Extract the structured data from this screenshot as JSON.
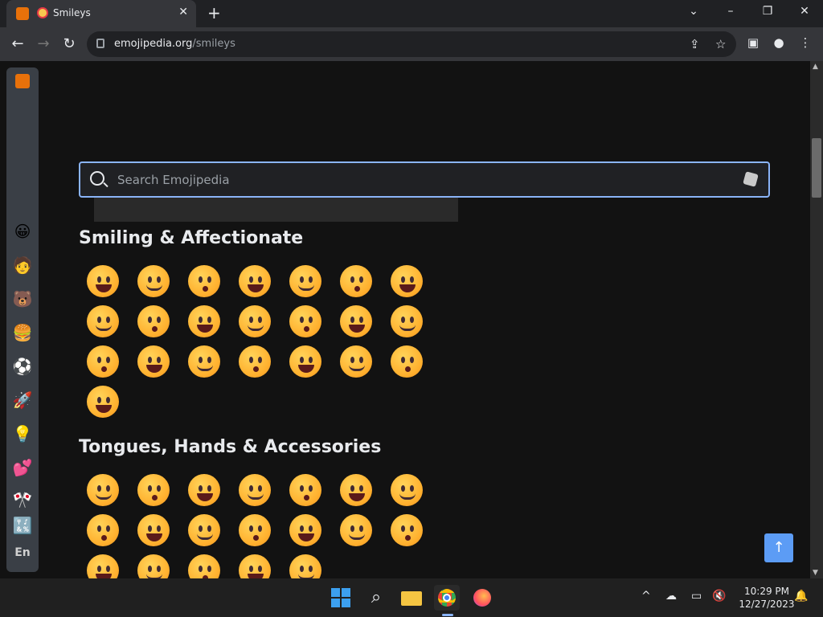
{
  "browser": {
    "tab_title": "Smileys",
    "url_host": "emojipedia.org",
    "url_path": "/smileys"
  },
  "search": {
    "placeholder": "Search Emojipedia"
  },
  "sidebar": {
    "lang_label": "En",
    "items": [
      "emojipedia-logo",
      "smiley",
      "person",
      "bear",
      "burger",
      "soccer-ball",
      "rocket",
      "light-bulb",
      "hearts",
      "flags",
      "symbols"
    ]
  },
  "sections": [
    {
      "title": "Smiling & Affectionate",
      "count": 22
    },
    {
      "title": "Tongues, Hands & Accessories",
      "count": 19
    }
  ],
  "taskbar": {
    "time": "10:29 PM",
    "date": "12/27/2023"
  },
  "colors": {
    "accent": "#8ab4f8",
    "to_top": "#5c9cf5"
  }
}
